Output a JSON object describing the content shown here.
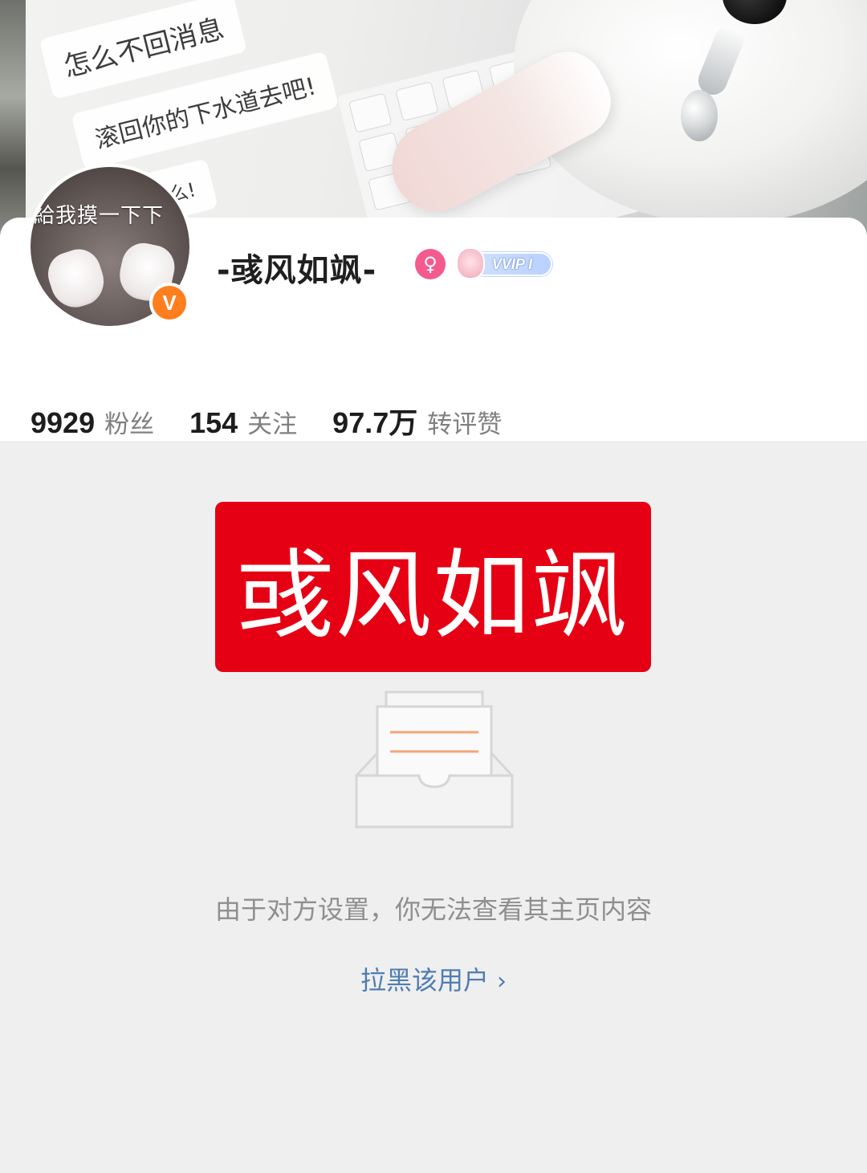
{
  "cover": {
    "chat_lines": [
      "怎么不回消息",
      "滚回你的下水道去吧!",
      "装什么!"
    ]
  },
  "profile": {
    "avatar_caption": "給我摸一下下",
    "verified_mark": "V",
    "username": "-彧风如飒-",
    "gender_symbol": "♀",
    "vip_label": "VVIP I"
  },
  "stats": [
    {
      "value": "9929",
      "label": "粉丝"
    },
    {
      "value": "154",
      "label": "关注"
    },
    {
      "value": "97.7万",
      "label": "转评赞"
    }
  ],
  "overlay_banner": {
    "text": "彧风如飒",
    "color": "#e60013"
  },
  "empty_state": {
    "icon": "empty-inbox-icon",
    "message": "由于对方设置，你无法查看其主页内容",
    "action_label": "拉黑该用户",
    "action_icon": "chevron-right-icon",
    "link_color": "#4f7db1"
  }
}
